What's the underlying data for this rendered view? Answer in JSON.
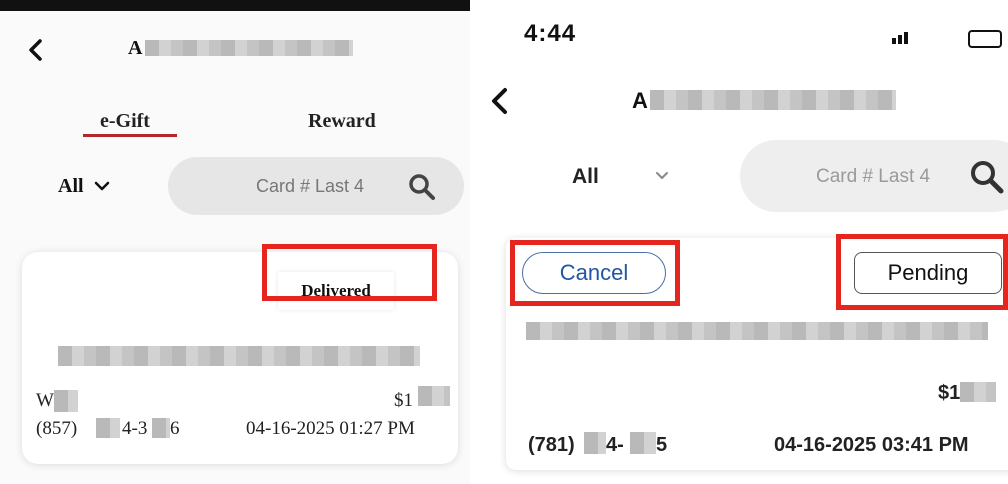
{
  "left": {
    "header": {
      "title_visible": "A"
    },
    "tabs": [
      {
        "label": "e-Gift",
        "active": true
      },
      {
        "label": "Reward",
        "active": false
      }
    ],
    "filter": {
      "selected": "All",
      "icon": "chevron-down-icon"
    },
    "search": {
      "placeholder": "Card # Last 4",
      "icon": "search-icon"
    },
    "card": {
      "status": "Delivered",
      "recipient_initial": "W",
      "amount_prefix": "$1",
      "phone_prefix": "(857)",
      "phone_mid": "4-3",
      "phone_end": "6",
      "datetime": "04-16-2025 01:27 PM"
    }
  },
  "right": {
    "status_bar": {
      "time": "4:44"
    },
    "header": {
      "title_visible": "A"
    },
    "filter": {
      "selected": "All",
      "icon": "chevron-down-icon"
    },
    "search": {
      "placeholder": "Card # Last 4",
      "icon": "search-icon"
    },
    "card": {
      "cancel_label": "Cancel",
      "status_label": "Pending",
      "amount_prefix": "$1",
      "phone_prefix": "(781)",
      "phone_mid": "4-",
      "phone_end": "5",
      "datetime": "04-16-2025 03:41 PM"
    }
  },
  "colors": {
    "tab_underline": "#b3262b",
    "highlight_box": "#e5261f",
    "cancel_text": "#1f57a4",
    "search_bg": "#e6e6e6"
  }
}
